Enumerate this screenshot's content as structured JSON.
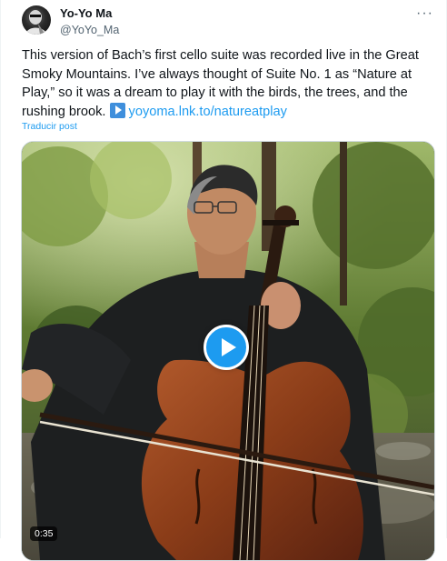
{
  "author": {
    "display_name": "Yo-Yo Ma",
    "handle": "@YoYo_Ma"
  },
  "menu": {
    "more_label": "···"
  },
  "post": {
    "text": "This version of Bach’s first cello suite was recorded live in the Great Smoky Mountains. I’ve always thought of Suite No. 1 as “Nature at Play,” so it was a dream to play it with the birds, the trees, and the rushing brook.",
    "link_text": "yoyoma.lnk.to/natureatplay",
    "link_icon": "play-arrow-emoji-icon",
    "translate_label": "Traducir post"
  },
  "video": {
    "duration": "0:35",
    "play_icon": "play-icon"
  },
  "colors": {
    "link": "#1d9bf0",
    "play_button": "#1d9bf0",
    "secondary_text": "#536471"
  }
}
